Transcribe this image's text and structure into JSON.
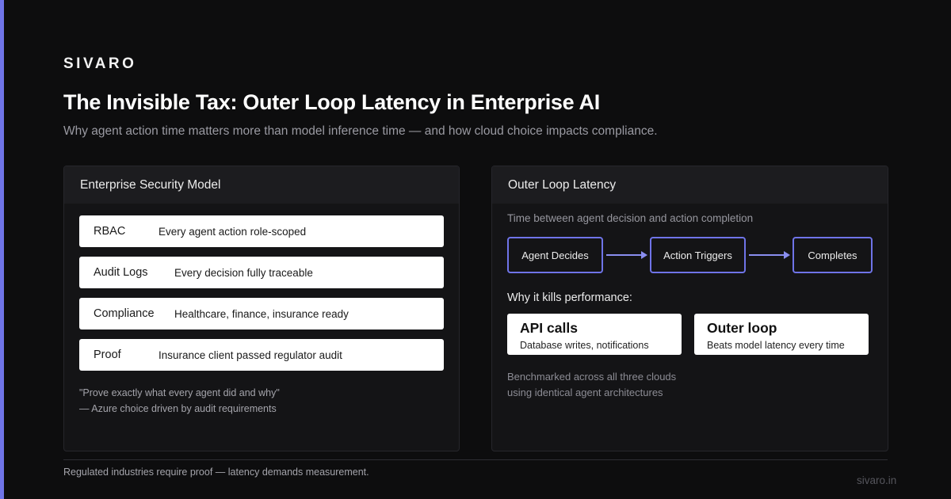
{
  "brand": "SIVARO",
  "title": "The Invisible Tax: Outer Loop Latency in Enterprise AI",
  "subtitle": "Why agent action time matters more than model inference time — and how cloud choice impacts compliance.",
  "colors": {
    "accent": "#6f74e8",
    "background": "#0d0d0e",
    "panel": "#141416"
  },
  "security": {
    "heading": "Enterprise Security Model",
    "rows": [
      {
        "key": "RBAC",
        "value": "Every agent action role-scoped"
      },
      {
        "key": "Audit Logs",
        "value": "Every decision fully traceable"
      },
      {
        "key": "Compliance",
        "value": "Healthcare, finance, insurance ready"
      },
      {
        "key": "Proof",
        "value": "Insurance client passed regulator audit"
      }
    ],
    "quote": "\"Prove exactly what every agent did and why\"",
    "attribution": "— Azure choice driven by audit requirements"
  },
  "latency": {
    "heading": "Outer Loop Latency",
    "description": "Time between agent decision and action completion",
    "flow": [
      "Agent Decides",
      "Action Triggers",
      "Completes"
    ],
    "why_label": "Why it kills performance:",
    "cards": [
      {
        "title": "API calls",
        "subtitle": "Database writes, notifications"
      },
      {
        "title": "Outer loop",
        "subtitle": "Beats model latency every time"
      }
    ],
    "note_line1": "Benchmarked across all three clouds",
    "note_line2": "using identical agent architectures"
  },
  "footer": "Regulated industries require proof — latency demands measurement.",
  "site": "sivaro.in"
}
